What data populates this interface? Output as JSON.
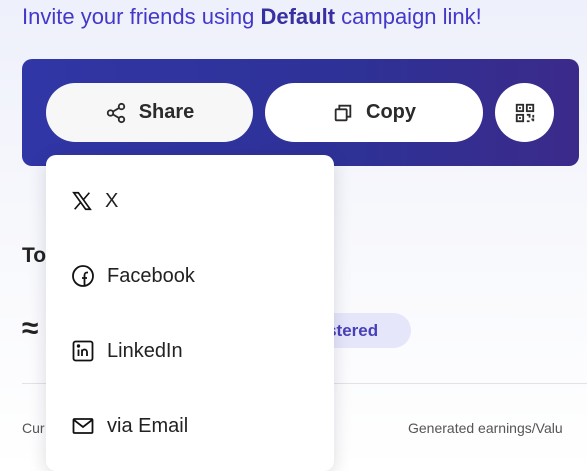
{
  "headline": {
    "prefix": "Invite your friends using ",
    "campaign": "Default",
    "suffix": " campaign link!"
  },
  "share_panel": {
    "share_label": "Share",
    "copy_label": "Copy",
    "qr_icon": "qr-code-icon"
  },
  "background": {
    "section_title_partial": "To",
    "approx_symbol": "≈",
    "badge_partial": "gistered",
    "col_left_partial": "Cur",
    "col_right_partial": "Generated earnings/Valu"
  },
  "share_menu": {
    "items": [
      {
        "label": "X",
        "icon": "x-logo-icon"
      },
      {
        "label": "Facebook",
        "icon": "facebook-icon"
      },
      {
        "label": "LinkedIn",
        "icon": "linkedin-icon"
      },
      {
        "label": "via Email",
        "icon": "email-icon"
      }
    ]
  },
  "colors": {
    "panel": "#2e3196",
    "accent_text": "#4338ca",
    "badge_bg": "#e6e6fb"
  }
}
